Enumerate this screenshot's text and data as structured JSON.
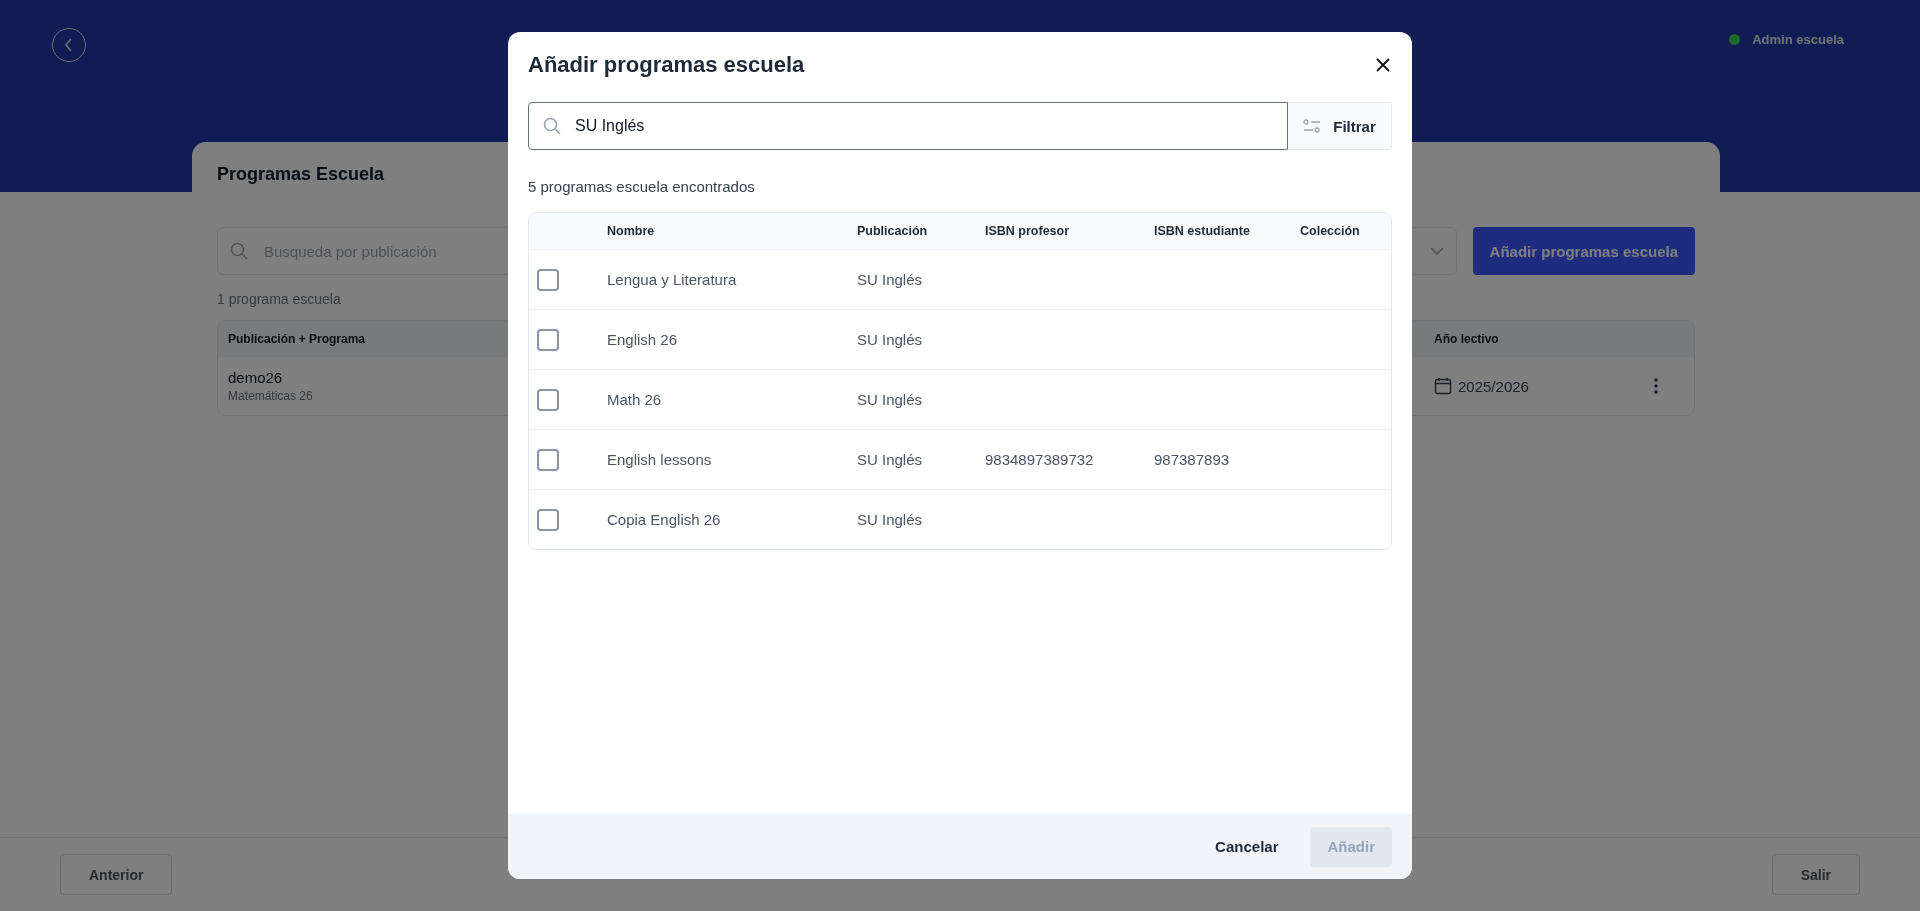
{
  "header": {
    "user": {
      "name": "Admin escuela",
      "online": true
    }
  },
  "page": {
    "title": "Programas Escuela",
    "search": {
      "placeholder": "Busqueda por publicación"
    },
    "count": "1 programa escuela",
    "add_button": "Añadir programas escuela",
    "table": {
      "columns": [
        "Publicación + Programa",
        "Año lectivo"
      ],
      "rows": [
        {
          "title": "demo26",
          "subtitle": "Matemáticas 26",
          "year": "2025/2026"
        }
      ]
    }
  },
  "footer": {
    "buttons": [
      "Anterior",
      "Salir"
    ]
  },
  "dialog": {
    "title": "Añadir programas escuela",
    "search": {
      "value": "SU Inglés"
    },
    "filter_button": "Filtrar",
    "result_count": "5 programas escuela encontrados",
    "table": {
      "columns": [
        "Nombre",
        "Publicación",
        "ISBN profesor",
        "ISBN estudiante",
        "Colección"
      ],
      "rows": [
        {
          "checked": false,
          "cells": [
            "Lengua y Literatura",
            "SU Inglés"
          ]
        },
        {
          "checked": false,
          "cells": [
            "English 26",
            "SU Inglés"
          ]
        },
        {
          "checked": false,
          "cells": [
            "Math 26",
            "SU Inglés"
          ]
        },
        {
          "checked": false,
          "cells": [
            "English lessons",
            "SU Inglés",
            "9834897389732",
            "987387893"
          ]
        },
        {
          "checked": false,
          "cells": [
            "Copia English 26",
            "SU Inglés"
          ]
        }
      ]
    },
    "cancel_button": "Cancelar",
    "add_button": {
      "label": "Añadir",
      "disabled": true
    }
  }
}
